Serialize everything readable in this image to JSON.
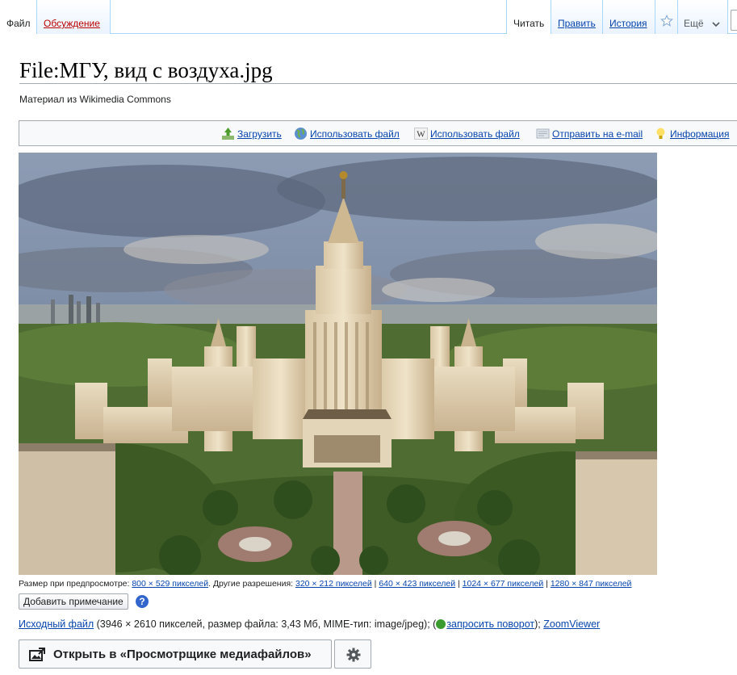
{
  "tabs": {
    "file": "Файл",
    "talk": "Обсуждение",
    "read": "Читать",
    "edit": "Править",
    "history": "История",
    "more": "Ещё"
  },
  "page": {
    "title": "File:МГУ, вид с воздуха.jpg",
    "subtitle": "Материал из Wikimedia Commons"
  },
  "file_toolbar": {
    "upload": "Загрузить",
    "use_file_1": "Использовать файл",
    "use_file_2": "Использовать файл",
    "email": "Отправить на e-mail",
    "info": "Информация"
  },
  "image": {
    "subject": "Aerial view of Moscow State University main building"
  },
  "preview": {
    "prefix": "Размер при предпросмотре: ",
    "current": "800 × 529 пикселей",
    "other_label": ". Другие разрешения: ",
    "r1": "320 × 212 пикселей",
    "r2": "640 × 423 пикселей",
    "r3": "1024 × 677 пикселей",
    "r4": "1280 × 847 пикселей",
    "sep": " | "
  },
  "annotate_button": "Добавить примечание",
  "original": {
    "link": "Исходный файл",
    "info": " (3946 × 2610 пикселей, размер файла: 3,43 Мб, MIME-тип: image/jpeg); (",
    "rotate": "запросить поворот",
    "close": "); ",
    "zoom": "ZoomViewer"
  },
  "media_viewer_button": "Открыть в «Просмотрщике медиафайлов»",
  "colors": {
    "link": "#0645ad",
    "new_link": "#ba0000",
    "border": "#a2a9b1",
    "tab_border": "#a7d7f9"
  }
}
